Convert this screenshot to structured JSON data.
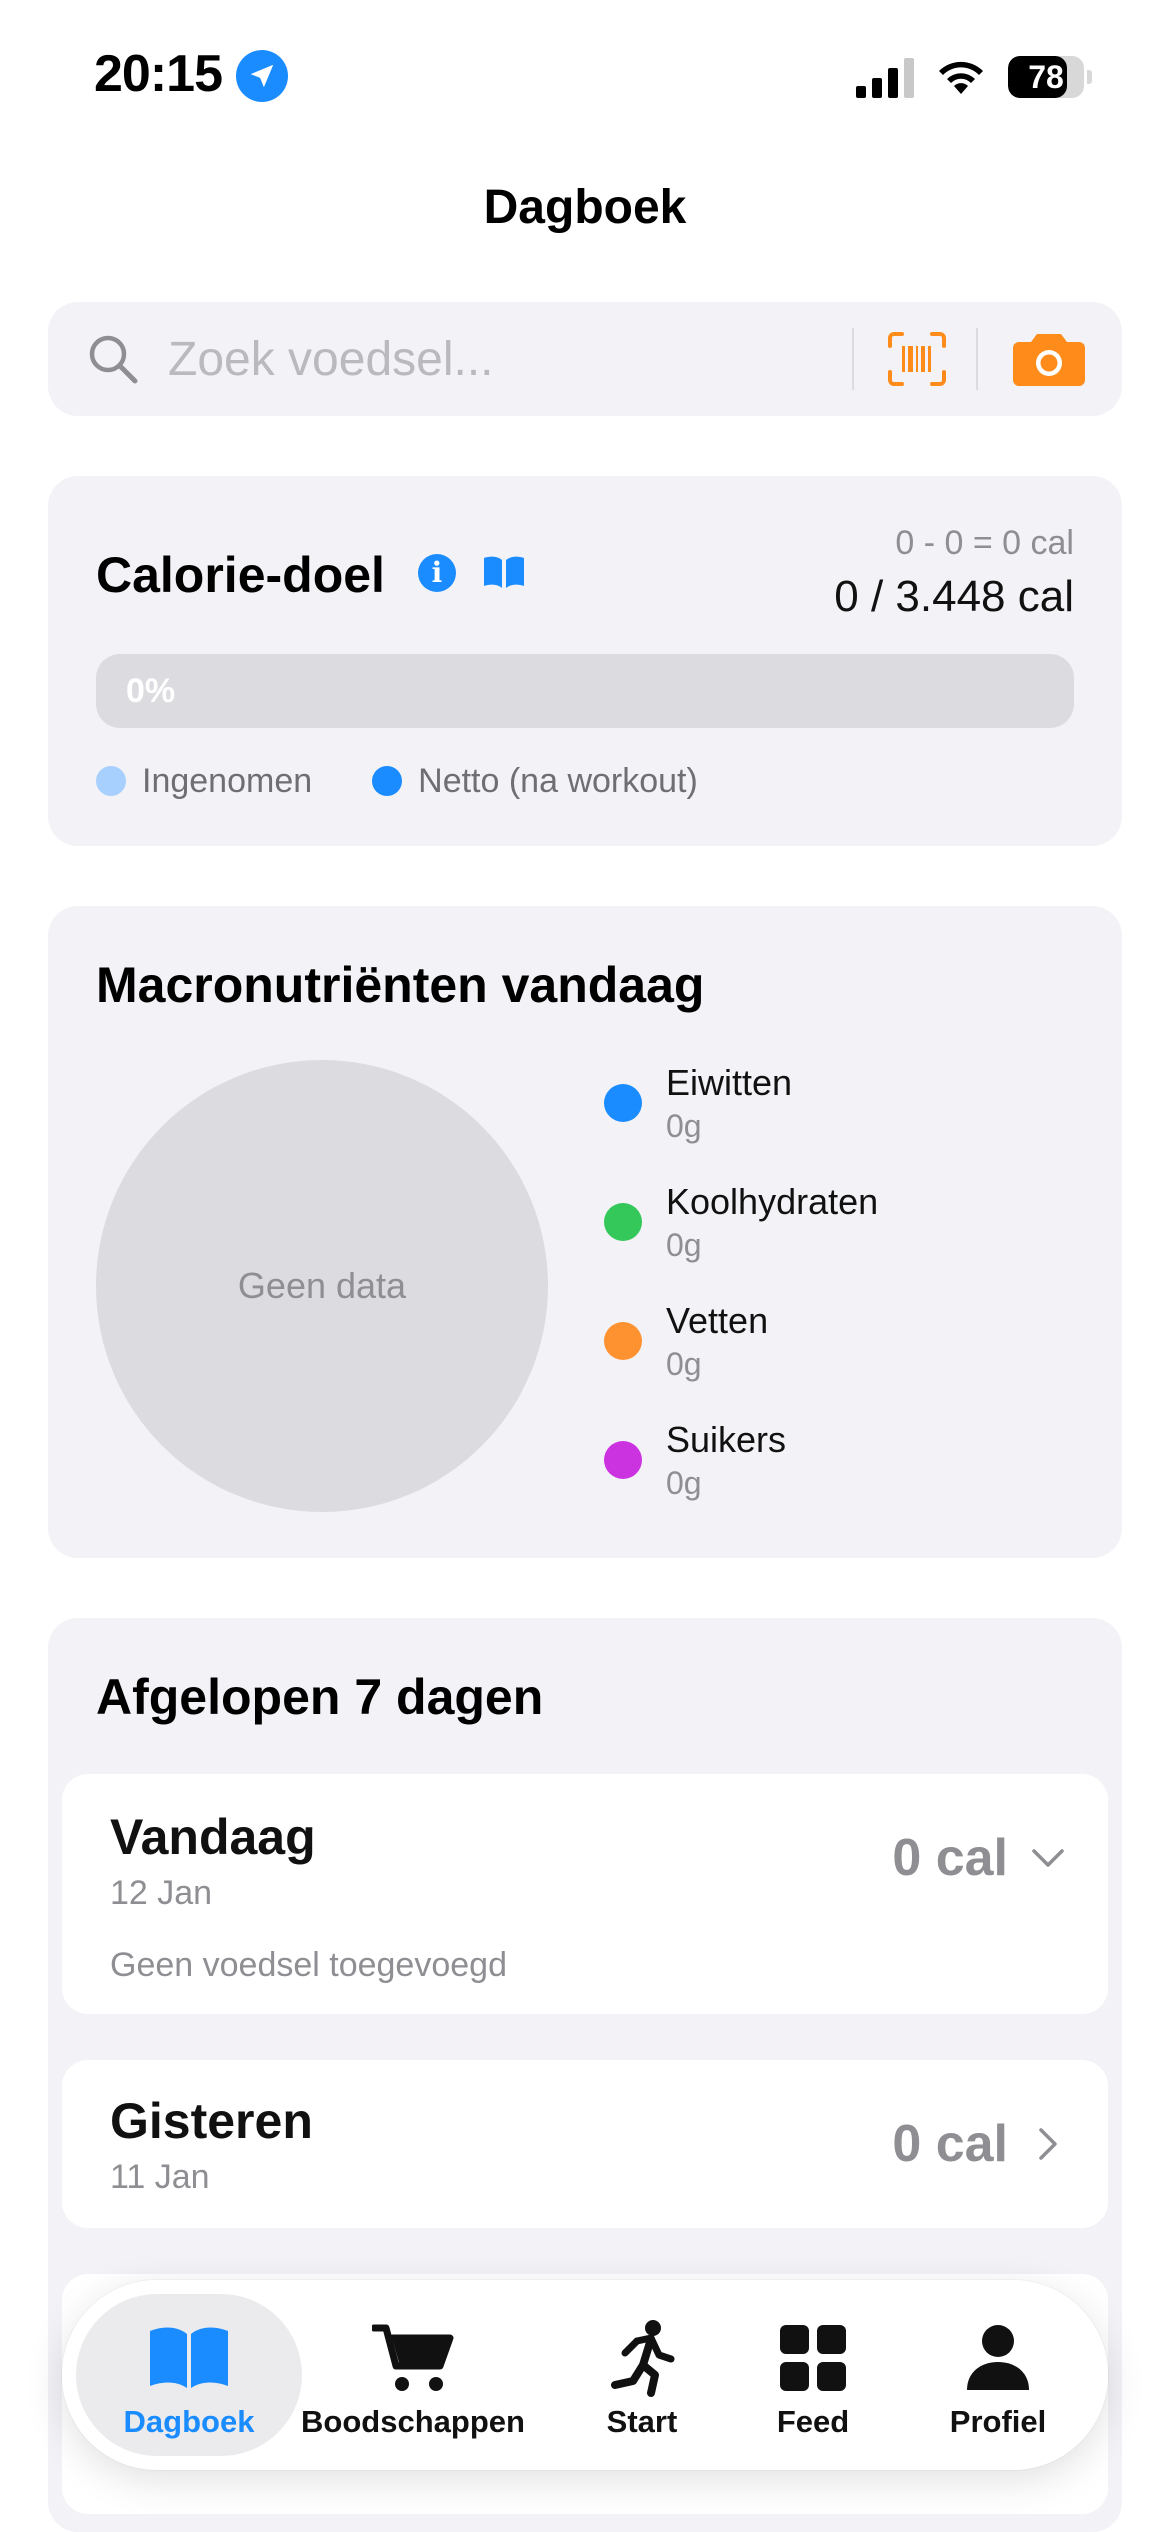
{
  "status_bar": {
    "time": "20:15",
    "battery_percent": "78",
    "battery_level": 0.78
  },
  "header": {
    "title": "Dagboek"
  },
  "search": {
    "placeholder": "Zoek voedsel..."
  },
  "calorie_card": {
    "title": "Calorie-doel",
    "formula": "0 - 0 = 0 cal",
    "total": "0 / 3.448 cal",
    "progress_label": "0%",
    "progress_fraction": 0,
    "legend": [
      {
        "label": "Ingenomen",
        "color": "#a8d0ff"
      },
      {
        "label": "Netto (na workout)",
        "color": "#1a8cff"
      }
    ]
  },
  "macro_card": {
    "title": "Macronutriënten vandaag",
    "empty_label": "Geen data",
    "items": [
      {
        "name": "Eiwitten",
        "value": "0g",
        "color": "#1a8cff"
      },
      {
        "name": "Koolhydraten",
        "value": "0g",
        "color": "#34c759"
      },
      {
        "name": "Vetten",
        "value": "0g",
        "color": "#ff9230"
      },
      {
        "name": "Suikers",
        "value": "0g",
        "color": "#cc33e0"
      }
    ]
  },
  "history_card": {
    "title": "Afgelopen 7 dagen",
    "days": [
      {
        "title": "Vandaag",
        "date": "12 Jan",
        "calories": "0 cal",
        "empty_text": "Geen voedsel toegevoegd"
      },
      {
        "title": "Gisteren",
        "date": "11 Jan",
        "calories": "0 cal"
      }
    ]
  },
  "tabs": [
    {
      "label": "Dagboek",
      "icon": "book-icon",
      "active": true
    },
    {
      "label": "Boodschappen",
      "icon": "cart-icon"
    },
    {
      "label": "Start",
      "icon": "runner-icon"
    },
    {
      "label": "Feed",
      "icon": "grid-icon"
    },
    {
      "label": "Profiel",
      "icon": "person-icon"
    }
  ],
  "colors": {
    "accent": "#1a8cff",
    "orange": "#ff8c1a",
    "card_bg": "#f2f2f7"
  }
}
